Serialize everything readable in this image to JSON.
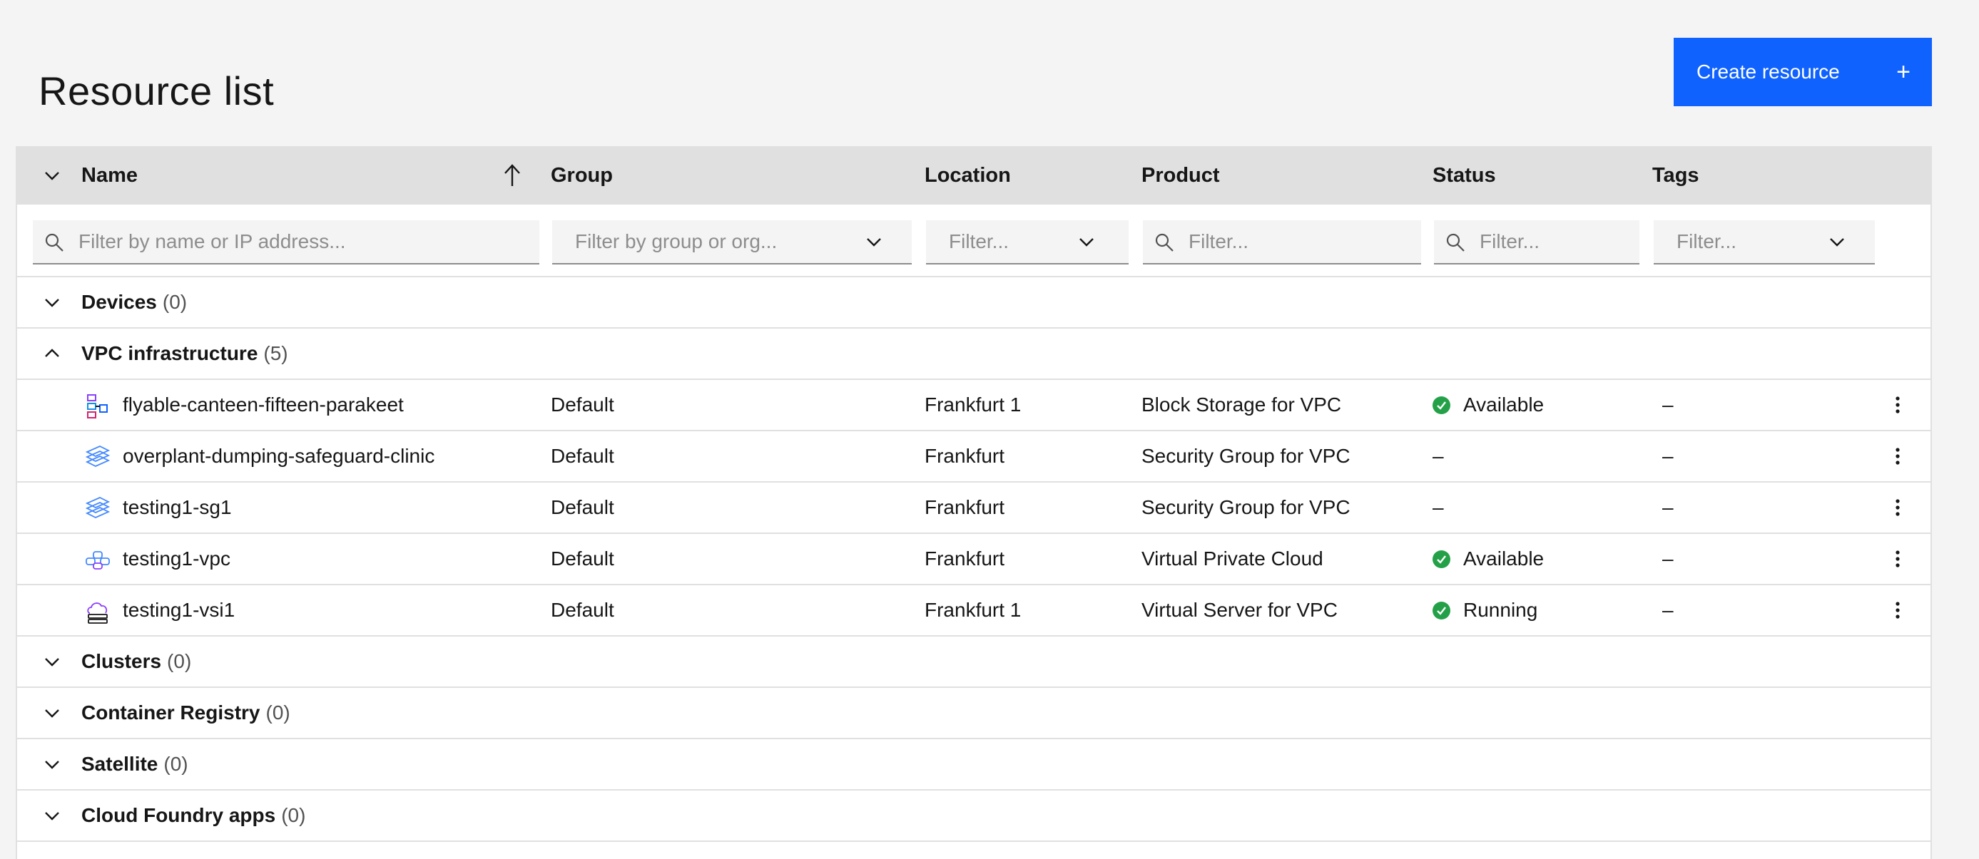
{
  "page": {
    "title": "Resource list",
    "create_button_label": "Create resource",
    "create_button_icon": "plus-icon"
  },
  "table": {
    "headers": {
      "name": "Name",
      "group": "Group",
      "location": "Location",
      "product": "Product",
      "status": "Status",
      "tags": "Tags"
    },
    "sort": {
      "column": "Name",
      "direction": "ascending",
      "icon": "arrow-up-icon"
    },
    "filters": {
      "name": "Filter by name or IP address...",
      "group": "Filter by group or org...",
      "location": "Filter...",
      "product": "Filter...",
      "status": "Filter...",
      "tags": "Filter..."
    },
    "groups": {
      "devices": {
        "label": "Devices",
        "count": "(0)"
      },
      "vpc": {
        "label": "VPC infrastructure",
        "count": "(5)"
      },
      "clusters": {
        "label": "Clusters",
        "count": "(0)"
      },
      "container_registry": {
        "label": "Container Registry",
        "count": "(0)"
      },
      "satellite": {
        "label": "Satellite",
        "count": "(0)"
      },
      "cloud_foundry": {
        "label": "Cloud Foundry apps",
        "count": "(0)"
      }
    },
    "rows": [
      {
        "name": "flyable-canteen-fifteen-parakeet",
        "group": "Default",
        "location": "Frankfurt 1",
        "product": "Block Storage for VPC",
        "status": "Available",
        "tags": "–",
        "icon": "block-storage-icon"
      },
      {
        "name": "overplant-dumping-safeguard-clinic",
        "group": "Default",
        "location": "Frankfurt",
        "product": "Security Group for VPC",
        "status": "–",
        "tags": "–",
        "icon": "security-group-icon"
      },
      {
        "name": "testing1-sg1",
        "group": "Default",
        "location": "Frankfurt",
        "product": "Security Group for VPC",
        "status": "–",
        "tags": "–",
        "icon": "security-group-icon"
      },
      {
        "name": "testing1-vpc",
        "group": "Default",
        "location": "Frankfurt",
        "product": "Virtual Private Cloud",
        "status": "Available",
        "tags": "–",
        "icon": "vpc-icon"
      },
      {
        "name": "testing1-vsi1",
        "group": "Default",
        "location": "Frankfurt 1",
        "product": "Virtual Server for VPC",
        "status": "Running",
        "tags": "–",
        "icon": "virtual-server-icon"
      }
    ]
  },
  "colors": {
    "primary_button": "#0f62fe",
    "status_ok": "#24a148",
    "header_bg": "#e0e0e0",
    "page_bg": "#f4f4f4"
  }
}
